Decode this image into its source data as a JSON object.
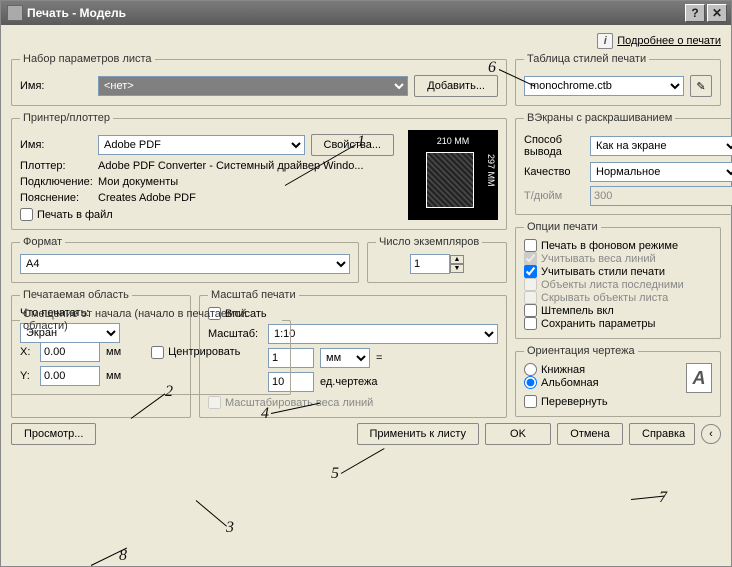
{
  "window": {
    "title": "Печать - Модель"
  },
  "header": {
    "more_link": "Подробнее о печати"
  },
  "page_set": {
    "legend": "Набор параметров листа",
    "name_label": "Имя:",
    "name_value": "<нет>",
    "add_btn": "Добавить..."
  },
  "printer": {
    "legend": "Принтер/плоттер",
    "name_label": "Имя:",
    "name_value": "Adobe PDF",
    "props_btn": "Свойства...",
    "plotter_label": "Плоттер:",
    "plotter_value": "Adobe PDF Converter - Системный драйвер Windo...",
    "conn_label": "Подключение:",
    "conn_value": "Мои документы",
    "desc_label": "Пояснение:",
    "desc_value": "Creates Adobe PDF",
    "to_file": "Печать в файл",
    "preview_w": "210 MM",
    "preview_h": "297 MM"
  },
  "paper": {
    "legend": "Формат",
    "value": "A4",
    "copies_legend": "Число экземпляров",
    "copies_value": "1"
  },
  "area": {
    "legend": "Печатаемая область",
    "what_label": "Что печатать:",
    "what_value": "Экран"
  },
  "scale": {
    "legend": "Масштаб печати",
    "fit": "Вписать",
    "scale_label": "Масштаб:",
    "scale_value": "1:10",
    "unit_count": "1",
    "unit": "мм",
    "eq": "=",
    "dwg_count": "10",
    "dwg_unit": "ед.чертежа",
    "lineweights": "Масштабировать веса линий"
  },
  "offset": {
    "legend": "Смещение от начала (начало в печатаемой области)",
    "x_label": "X:",
    "x_value": "0.00",
    "y_label": "Y:",
    "y_value": "0.00",
    "unit": "мм",
    "center": "Центрировать"
  },
  "styles": {
    "legend": "Таблица стилей печати",
    "value": "monochrome.ctb"
  },
  "shaded": {
    "legend": "ВЭкраны с раскрашиванием",
    "mode_label": "Способ вывода",
    "mode_value": "Как на экране",
    "quality_label": "Качество",
    "quality_value": "Нормальное",
    "dpi_label": "Т/дюйм",
    "dpi_value": "300"
  },
  "options": {
    "legend": "Опции печати",
    "bg": "Печать в фоновом режиме",
    "lw": "Учитывать веса линий",
    "styles": "Учитывать стили печати",
    "last": "Объекты листа последними",
    "hide": "Скрывать объекты листа",
    "stamp": "Штемпель вкл",
    "save": "Сохранить параметры"
  },
  "orient": {
    "legend": "Ориентация чертежа",
    "portrait": "Книжная",
    "landscape": "Альбомная",
    "upside": "Перевернуть"
  },
  "footer": {
    "preview": "Просмотр...",
    "apply": "Применить к листу",
    "ok": "OK",
    "cancel": "Отмена",
    "help": "Справка"
  },
  "annotations": {
    "n1": "1",
    "n2": "2",
    "n3": "3",
    "n4": "4",
    "n5": "5",
    "n6": "6",
    "n7": "7",
    "n8": "8"
  }
}
